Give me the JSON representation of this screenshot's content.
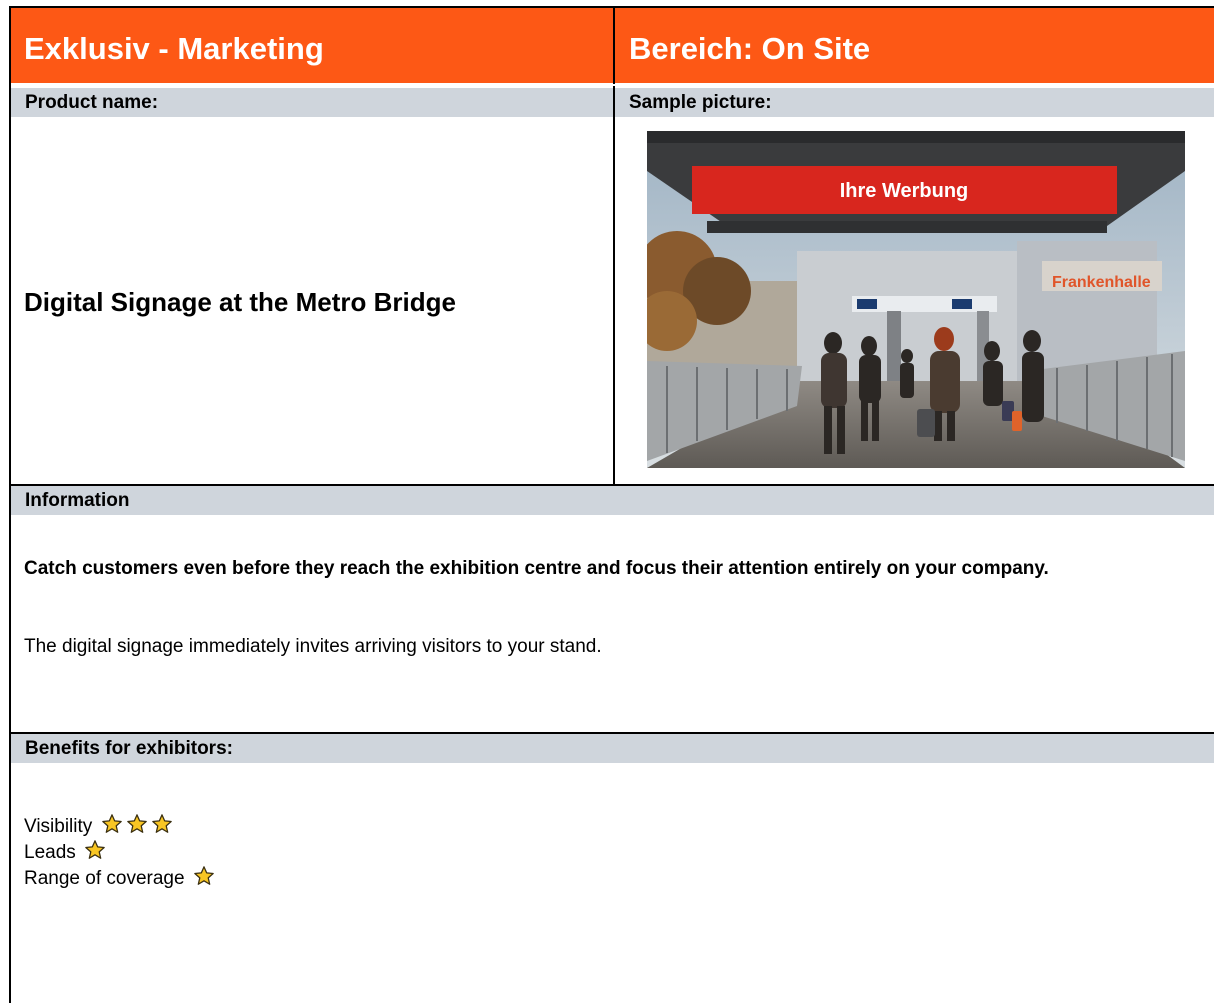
{
  "header": {
    "left_title": "Exklusiv - Marketing",
    "right_title": "Bereich: On Site",
    "color": "#fd5815"
  },
  "product": {
    "name_label": "Product name:",
    "picture_label": "Sample picture:",
    "name": "Digital Signage at the Metro Bridge",
    "photo_sign_text": "Ihre Werbung"
  },
  "information": {
    "label": "Information",
    "headline": "Catch customers even before they reach the exhibition centre and focus their attention entirely on your company.",
    "body": "The digital signage immediately invites arriving visitors to your stand."
  },
  "benefits": {
    "label": "Benefits for exhibitors:",
    "items": [
      {
        "label": "Visibility",
        "stars": 3
      },
      {
        "label": "Leads",
        "stars": 1
      },
      {
        "label": "Range of coverage",
        "stars": 1
      }
    ],
    "star_icon": "star-icon",
    "star_color": "#f9c623"
  }
}
